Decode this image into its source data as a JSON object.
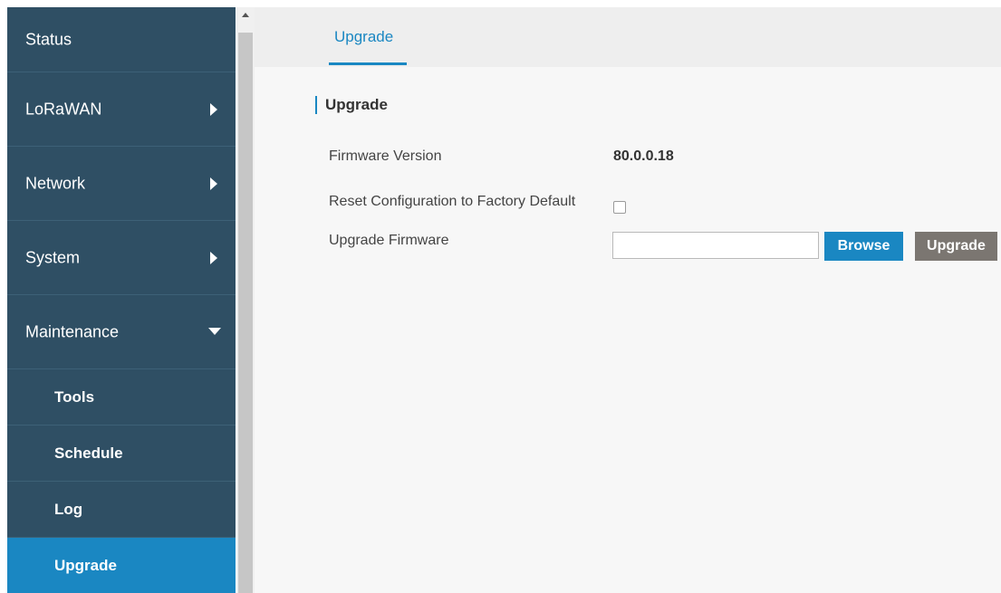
{
  "sidebar": {
    "items": [
      {
        "label": "Status"
      },
      {
        "label": "LoRaWAN"
      },
      {
        "label": "Network"
      },
      {
        "label": "System"
      },
      {
        "label": "Maintenance"
      }
    ],
    "maintenance_subitems": [
      {
        "label": "Tools"
      },
      {
        "label": "Schedule"
      },
      {
        "label": "Log"
      },
      {
        "label": "Upgrade",
        "active": true
      }
    ]
  },
  "main": {
    "tabs": [
      {
        "label": "Upgrade",
        "active": true
      }
    ],
    "section_title": "Upgrade",
    "fields": {
      "firmware_version_label": "Firmware Version",
      "firmware_version_value": "80.0.0.18",
      "reset_label": "Reset Configuration to Factory Default",
      "reset_checked": false,
      "upgrade_firmware_label": "Upgrade Firmware",
      "upgrade_firmware_value": ""
    },
    "buttons": {
      "browse": "Browse",
      "upgrade": "Upgrade"
    }
  },
  "colors": {
    "sidebar_bg": "#2f4f64",
    "accent": "#1a87c2",
    "upgrade_button": "#7b7671",
    "main_bg": "#f7f7f7"
  },
  "icons": {
    "submenu_collapsed": "caret-right-icon",
    "submenu_expanded": "caret-down-icon"
  }
}
